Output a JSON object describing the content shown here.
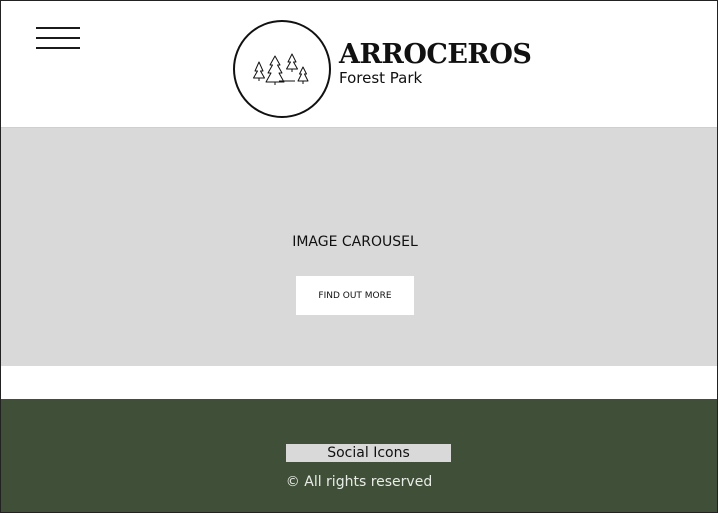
{
  "header": {
    "menu_icon": "hamburger-menu-icon",
    "logo_icon": "pine-trees-icon",
    "brand_title": "ARROCEROS",
    "brand_subtitle": "Forest Park"
  },
  "carousel": {
    "label": "IMAGE CAROUSEL",
    "cta_label": "FIND OUT MORE"
  },
  "footer": {
    "social_label": "Social Icons",
    "copyright": "© All rights reserved"
  },
  "colors": {
    "footer_bg": "#405038",
    "carousel_bg": "#d9d9d9",
    "page_bg": "#ffffff"
  }
}
